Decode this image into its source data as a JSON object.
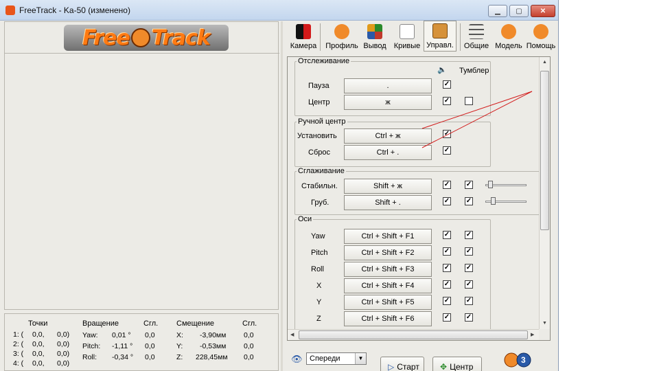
{
  "window": {
    "title": "FreeTrack - Ka-50  (изменено)"
  },
  "titlebar": {
    "minimize": "▁",
    "maximize": "▢",
    "close": "✕"
  },
  "logo": {
    "left": "Free",
    "right": "Track"
  },
  "bottom_panel": {
    "points_header": "Точки",
    "rotation_header": "Вращение",
    "deg_header_1": "Сгл.",
    "offset_header": "Смещение",
    "deg_header_2": "Сгл.",
    "points": [
      {
        "label": "1: (",
        "a": "0,0,",
        "b": "0,0)"
      },
      {
        "label": "2: (",
        "a": "0,0,",
        "b": "0,0)"
      },
      {
        "label": "3: (",
        "a": "0,0,",
        "b": "0,0)"
      },
      {
        "label": "4: (",
        "a": "0,0,",
        "b": "0,0)"
      }
    ],
    "rotation": [
      {
        "axis": "Yaw:",
        "value": "0,01 °",
        "smooth": "0,0"
      },
      {
        "axis": "Pitch:",
        "value": "-1,11 °",
        "smooth": "0,0"
      },
      {
        "axis": "Roll:",
        "value": "-0,34 °",
        "smooth": "0,0"
      }
    ],
    "offset": [
      {
        "axis": "X:",
        "value": "-3,90мм",
        "smooth": "0,0"
      },
      {
        "axis": "Y:",
        "value": "-0,53мм",
        "smooth": "0,0"
      },
      {
        "axis": "Z:",
        "value": "228,45мм",
        "smooth": "0,0"
      }
    ]
  },
  "toolbar": {
    "camera": "Камера",
    "profile": "Профиль",
    "output": "Вывод",
    "curves": "Кривые",
    "control": "Управл.",
    "general": "Общие",
    "model": "Модель",
    "help": "Помощь"
  },
  "groups": {
    "tracking": {
      "legend": "Отслеживание",
      "toggle_header": "Тумблер",
      "rows": [
        {
          "label": "Пауза",
          "key": "."
        },
        {
          "label": "Центр",
          "key": "ж"
        }
      ]
    },
    "manual_center": {
      "legend": "Ручной центр",
      "rows": [
        {
          "label": "Установить",
          "key": "Ctrl + ж"
        },
        {
          "label": "Сброс",
          "key": "Ctrl + ."
        }
      ]
    },
    "smoothing": {
      "legend": "Сглаживание",
      "rows": [
        {
          "label": "Стабильн.",
          "key": "Shift + ж"
        },
        {
          "label": "Груб.",
          "key": "Shift + ."
        }
      ]
    },
    "axes": {
      "legend": "Оси",
      "rows": [
        {
          "label": "Yaw",
          "key": "Ctrl + Shift + F1"
        },
        {
          "label": "Pitch",
          "key": "Ctrl + Shift + F2"
        },
        {
          "label": "Roll",
          "key": "Ctrl + Shift + F3"
        },
        {
          "label": "X",
          "key": "Ctrl + Shift + F4"
        },
        {
          "label": "Y",
          "key": "Ctrl + Shift + F5"
        },
        {
          "label": "Z",
          "key": "Ctrl + Shift + F6"
        }
      ]
    }
  },
  "checks": {
    "tracking_pause": true,
    "tracking_center": true,
    "tracking_center_toggle": false,
    "manual_set": true,
    "manual_reset": true,
    "smooth_stable_1": true,
    "smooth_stable_2": true,
    "smooth_rough_1": true,
    "smooth_rough_2": true,
    "axes": true
  },
  "footer": {
    "view_combo": "Спереди",
    "start_button": "Старт",
    "center_button": "Центр"
  },
  "colors": {
    "accent_orange": "#ff7a12",
    "annotation_red": "#d21a1a"
  }
}
